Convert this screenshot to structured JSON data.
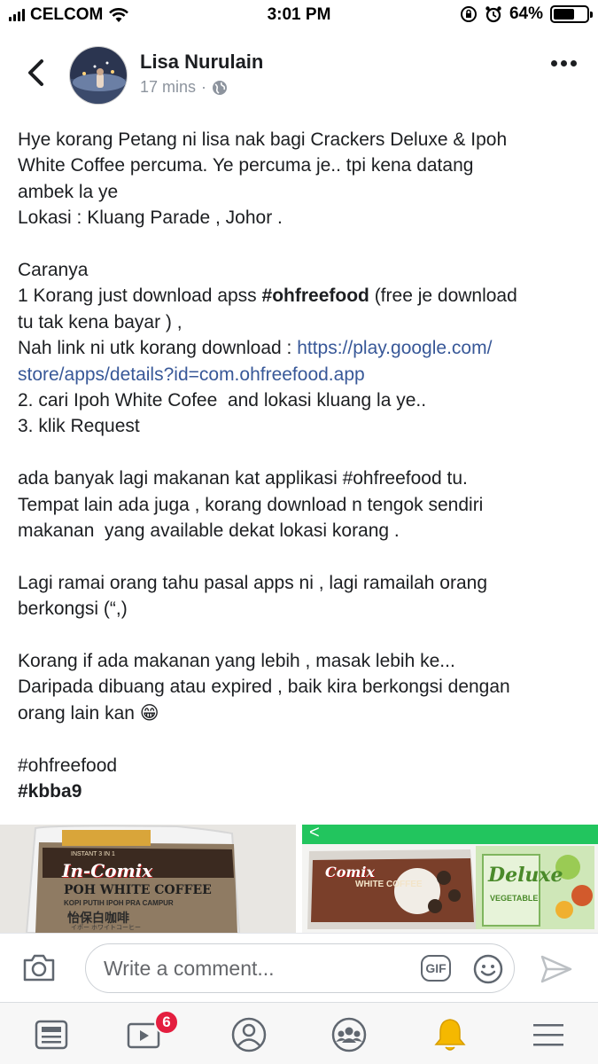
{
  "status_bar": {
    "carrier": "CELCOM",
    "time": "3:01 PM",
    "battery_percent": "64%",
    "battery_level": 0.64
  },
  "post": {
    "author": "Lisa Nurulain",
    "time_ago": "17 mins",
    "separator": "·",
    "privacy_icon": "globe-icon",
    "lines": [
      [
        {
          "t": "Hye korang Petang ni lisa nak bagi Crackers Deluxe & Ipoh"
        }
      ],
      [
        {
          "t": "White Coffee percuma. Ye percuma je.. tpi kena datang"
        }
      ],
      [
        {
          "t": "ambek la ye"
        }
      ],
      [
        {
          "t": "Lokasi : Kluang Parade , Johor ."
        }
      ],
      [],
      [
        {
          "t": "Caranya"
        }
      ],
      [
        {
          "t": "1 Korang just download apss "
        },
        {
          "t": "#ohfreefood",
          "s": "bold"
        },
        {
          "t": " (free je download"
        }
      ],
      [
        {
          "t": "tu tak kena bayar ) ,"
        }
      ],
      [
        {
          "t": "Nah link ni utk korang download : "
        },
        {
          "t": "https://play.google.com/",
          "s": "link"
        }
      ],
      [
        {
          "t": "store/apps/details?id=com.ohfreefood.app",
          "s": "link"
        }
      ],
      [
        {
          "t": "2. cari Ipoh White Cofee  and lokasi kluang la ye.."
        }
      ],
      [
        {
          "t": "3. klik Request"
        }
      ],
      [],
      [
        {
          "t": "ada banyak lagi makanan kat applikasi #ohfreefood tu."
        }
      ],
      [
        {
          "t": "Tempat lain ada juga , korang download n tengok sendiri"
        }
      ],
      [
        {
          "t": "makanan  yang available dekat lokasi korang ."
        }
      ],
      [],
      [
        {
          "t": "Lagi ramai orang tahu pasal apps ni , lagi ramailah orang"
        }
      ],
      [
        {
          "t": "berkongsi (“,)"
        }
      ],
      [],
      [
        {
          "t": "Korang if ada makanan yang lebih , masak lebih ke..."
        }
      ],
      [
        {
          "t": "Daripada dibuang atau expired , baik kira berkongsi dengan"
        }
      ],
      [
        {
          "t": "orang lain kan 😁"
        }
      ],
      [],
      [
        {
          "t": "#ohfreefood"
        }
      ],
      [
        {
          "t": "#kbba9",
          "s": "bold"
        }
      ]
    ]
  },
  "photos": {
    "left": {
      "brand": "In-Comix",
      "product": "POH WHITE COFFEE",
      "subtitle": "KOPI PUTIH IPOH PRA CAMPUR",
      "chinese": "怡保白咖啡",
      "small": "イポー ホワイトコーヒー",
      "tag": "INSTANT 3 IN 1"
    },
    "right": {
      "brand": "Comix",
      "product": "WHITE COFFEE",
      "box_brand": "Deluxe",
      "box_label": "VEGETABLE",
      "chevron": "<"
    }
  },
  "comment_bar": {
    "placeholder": "Write a comment...",
    "gif_label": "GIF",
    "icons": [
      "camera-icon",
      "emoji-icon",
      "send-icon"
    ]
  },
  "tab_bar": {
    "tabs": [
      "news-feed",
      "watch",
      "profile",
      "groups",
      "notifications",
      "menu"
    ],
    "watch_badge": "6",
    "active_tab": "notifications",
    "active_color": "#f5b800"
  },
  "colors": {
    "link": "#385898",
    "text": "#1c1e21",
    "meta": "#8d949e",
    "badge": "#e41e3f",
    "green_bar": "#22c55e"
  }
}
